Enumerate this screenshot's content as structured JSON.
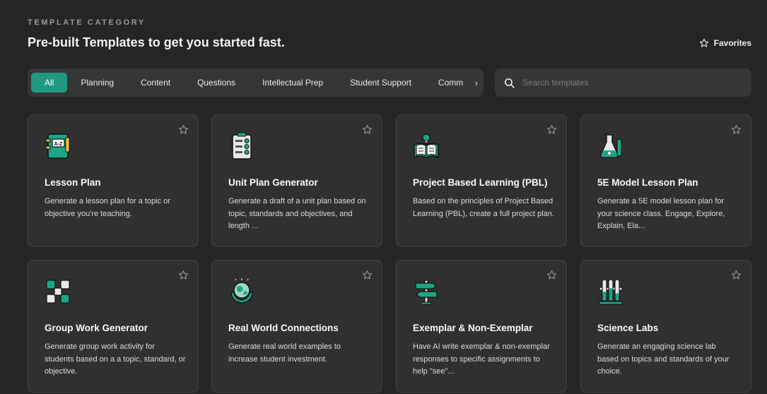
{
  "header": {
    "eyebrow": "TEMPLATE CATEGORY",
    "headline": "Pre-built Templates to get you started fast.",
    "favorites_label": "Favorites"
  },
  "tabs": [
    {
      "label": "All",
      "active": true
    },
    {
      "label": "Planning",
      "active": false
    },
    {
      "label": "Content",
      "active": false
    },
    {
      "label": "Questions",
      "active": false
    },
    {
      "label": "Intellectual Prep",
      "active": false
    },
    {
      "label": "Student Support",
      "active": false
    },
    {
      "label": "Comm",
      "active": false
    }
  ],
  "tabs_more_icon": "chevron-right-icon",
  "search": {
    "placeholder": "Search templates",
    "value": "",
    "icon": "search-icon"
  },
  "colors": {
    "accent": "#1f9a80",
    "background": "#252525",
    "card": "#303030"
  },
  "cards": [
    {
      "title": "Lesson Plan",
      "description": "Generate a lesson plan for a topic or objective you're teaching.",
      "icon": "notebook-icon"
    },
    {
      "title": "Unit Plan Generator",
      "description": "Generate a draft of a unit plan based on topic, standards and objectives, and length ...",
      "icon": "checklist-icon"
    },
    {
      "title": "Project Based Learning (PBL)",
      "description": "Based on the principles of Project Based Learning (PBL), create a full project plan.",
      "icon": "open-book-bulb-icon"
    },
    {
      "title": "5E Model Lesson Plan",
      "description": "Generate a 5E model lesson plan for your science class. Engage, Explore, Explain, Ela...",
      "icon": "lab-flask-icon"
    },
    {
      "title": "Group Work Generator",
      "description": "Generate group work activity for students based on a a topic, standard, or objective.",
      "icon": "team-hands-icon"
    },
    {
      "title": "Real World Connections",
      "description": "Generate real world examples to increase student investment.",
      "icon": "globe-hands-icon"
    },
    {
      "title": "Exemplar & Non-Exemplar",
      "description": "Have AI write exemplar & non-exemplar responses to specific assignments to help \"see\"...",
      "icon": "signpost-icon"
    },
    {
      "title": "Science Labs",
      "description": "Generate an engaging science lab based on topics and standards of your choice.",
      "icon": "test-tubes-icon"
    }
  ]
}
